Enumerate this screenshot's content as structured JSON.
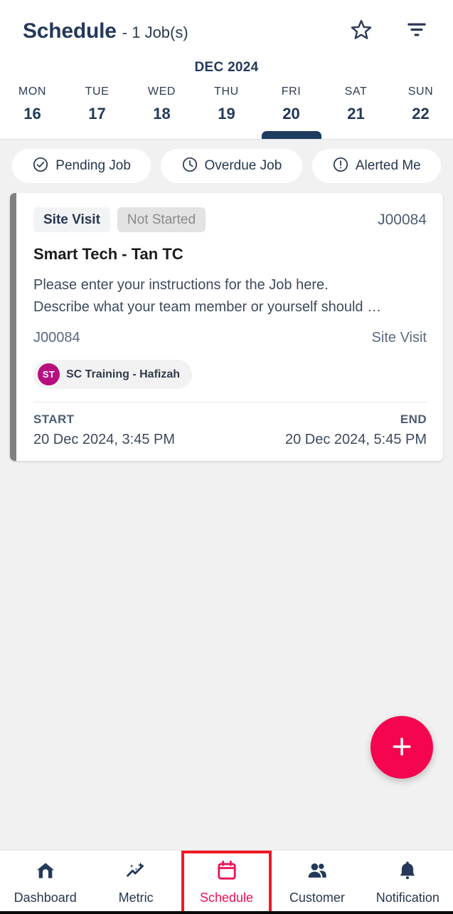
{
  "header": {
    "title": "Schedule",
    "subtitle": "- 1 Job(s)",
    "star_icon": "star-outline-icon",
    "filter_icon": "filter-icon"
  },
  "calendar": {
    "month_label": "DEC 2024",
    "selected_index": 4,
    "days": [
      {
        "dow": "MON",
        "num": "16"
      },
      {
        "dow": "TUE",
        "num": "17"
      },
      {
        "dow": "WED",
        "num": "18"
      },
      {
        "dow": "THU",
        "num": "19"
      },
      {
        "dow": "FRI",
        "num": "20"
      },
      {
        "dow": "SAT",
        "num": "21"
      },
      {
        "dow": "SUN",
        "num": "22"
      }
    ]
  },
  "filters": [
    {
      "label": "Pending Job",
      "icon": "check-circle-icon"
    },
    {
      "label": "Overdue Job",
      "icon": "clock-icon"
    },
    {
      "label": "Alerted Me",
      "icon": "exclamation-circle-icon"
    }
  ],
  "job": {
    "type_tag": "Site Visit",
    "status_tag": "Not Started",
    "job_id": "J00084",
    "title": "Smart Tech - Tan TC",
    "description_line1": "Please enter your instructions for the Job here.",
    "description_line2": "Describe what your team member or yourself should …",
    "meta_left": "J00084",
    "meta_right": "Site Visit",
    "assignee_initials": "ST",
    "assignee_name": "SC Training - Hafizah",
    "start_label": "START",
    "start_value": "20 Dec 2024, 3:45 PM",
    "end_label": "END",
    "end_value": "20 Dec 2024, 5:45 PM",
    "accent_color": "#808080"
  },
  "fab": {
    "icon": "plus-icon",
    "color": "#f5054f"
  },
  "bottom_nav": {
    "active_index": 2,
    "items": [
      {
        "label": "Dashboard",
        "icon": "home-icon"
      },
      {
        "label": "Metric",
        "icon": "sparkle-chart-icon"
      },
      {
        "label": "Schedule",
        "icon": "calendar-icon"
      },
      {
        "label": "Customer",
        "icon": "people-icon"
      },
      {
        "label": "Notification",
        "icon": "bell-icon"
      }
    ]
  },
  "colors": {
    "navy": "#24395a",
    "accent_pink": "#ef1054",
    "highlight_red": "#ee1a24",
    "avatar_magenta": "#b80f7e",
    "page_bg": "#f1f1f1"
  }
}
